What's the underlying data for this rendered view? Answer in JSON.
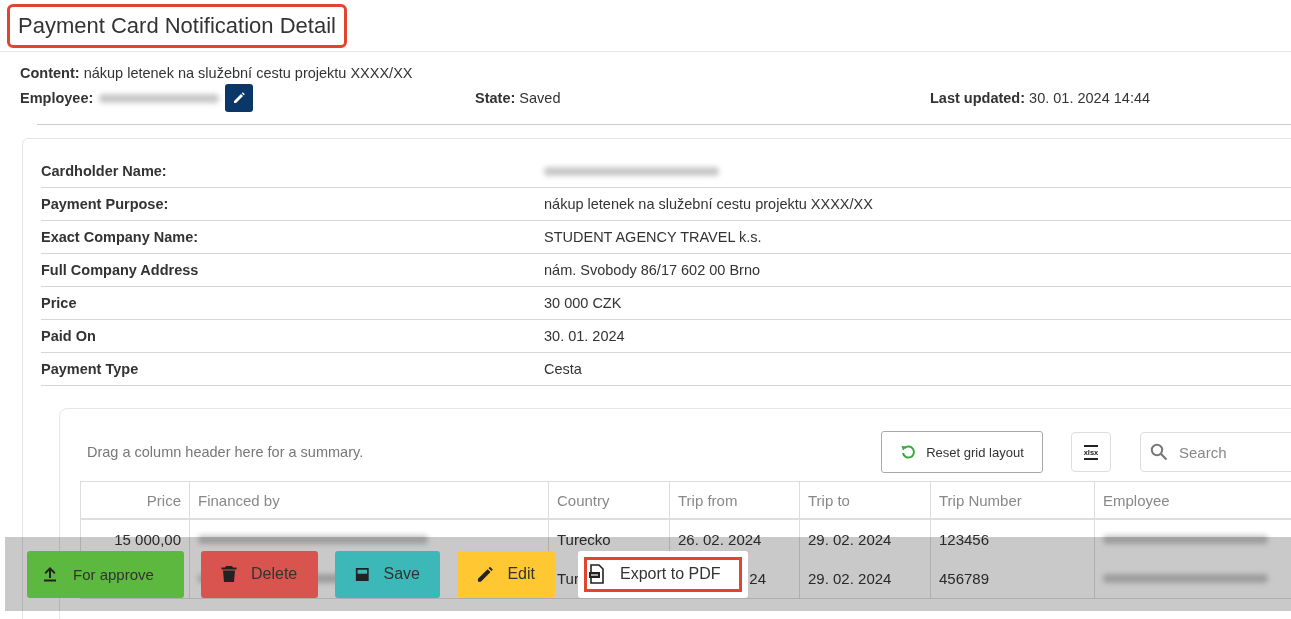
{
  "page_title": {
    "text": "Payment Card Notification Detail",
    "highlighted": true
  },
  "summary": {
    "content": {
      "label": "Content:",
      "value": "nákup letenek na služební cestu projektu XXXX/XX"
    },
    "employee": {
      "label": "Employee:",
      "blurred": true
    },
    "state": {
      "label": "State:",
      "value": "Saved"
    },
    "last_updated": {
      "label": "Last updated:",
      "value": "30. 01. 2024 14:44"
    }
  },
  "details": [
    {
      "label": "Cardholder Name:",
      "blurred": true
    },
    {
      "label": "Payment Purpose:",
      "value": "nákup letenek na služební cestu projektu XXXX/XX"
    },
    {
      "label": "Exact Company Name:",
      "value": "STUDENT AGENCY TRAVEL k.s."
    },
    {
      "label": "Full Company Address",
      "value": "nám. Svobody 86/17 602 00 Brno"
    },
    {
      "label": "Price",
      "value": "30 000 CZK"
    },
    {
      "label": "Paid On",
      "value": "30. 01. 2024"
    },
    {
      "label": "Payment Type",
      "value": "Cesta"
    }
  ],
  "grid": {
    "group_hint": "Drag a column header here for a summary.",
    "reset_button": "Reset grid layout",
    "export_excel": "xlsx",
    "search": {
      "placeholder": "Search"
    },
    "columns": [
      {
        "label": "Price",
        "kind": "numeric"
      },
      {
        "label": "Financed by",
        "kind": "text"
      },
      {
        "label": "Country",
        "kind": "text"
      },
      {
        "label": "Trip from",
        "kind": "text"
      },
      {
        "label": "Trip to",
        "kind": "text"
      },
      {
        "label": "Trip Number",
        "kind": "text"
      },
      {
        "label": "Employee",
        "kind": "text"
      }
    ],
    "rows": [
      {
        "cells": [
          {
            "text": "15 000,00"
          },
          {
            "blurred": true
          },
          {
            "text": "Turecko"
          },
          {
            "text": "26. 02. 2024"
          },
          {
            "text": "29. 02. 2024"
          },
          {
            "text": "123456"
          },
          {
            "blurred": true
          }
        ]
      },
      {
        "cells": [
          {},
          {
            "blurred": true
          },
          {
            "text": "Tur"
          },
          {
            "text": "24",
            "start_hidden": true
          },
          {
            "text": "29. 02. 2024"
          },
          {
            "text": "456789"
          },
          {
            "blurred": true
          }
        ]
      }
    ]
  },
  "actions": [
    {
      "label": "For approve",
      "kind": "approve",
      "highlighted": false
    },
    {
      "label": "Delete",
      "kind": "delete",
      "highlighted": false
    },
    {
      "label": "Save",
      "kind": "save",
      "highlighted": false
    },
    {
      "label": "Edit",
      "kind": "edit",
      "highlighted": false
    },
    {
      "label": "Export to PDF",
      "kind": "pdf",
      "highlighted": true
    }
  ]
}
